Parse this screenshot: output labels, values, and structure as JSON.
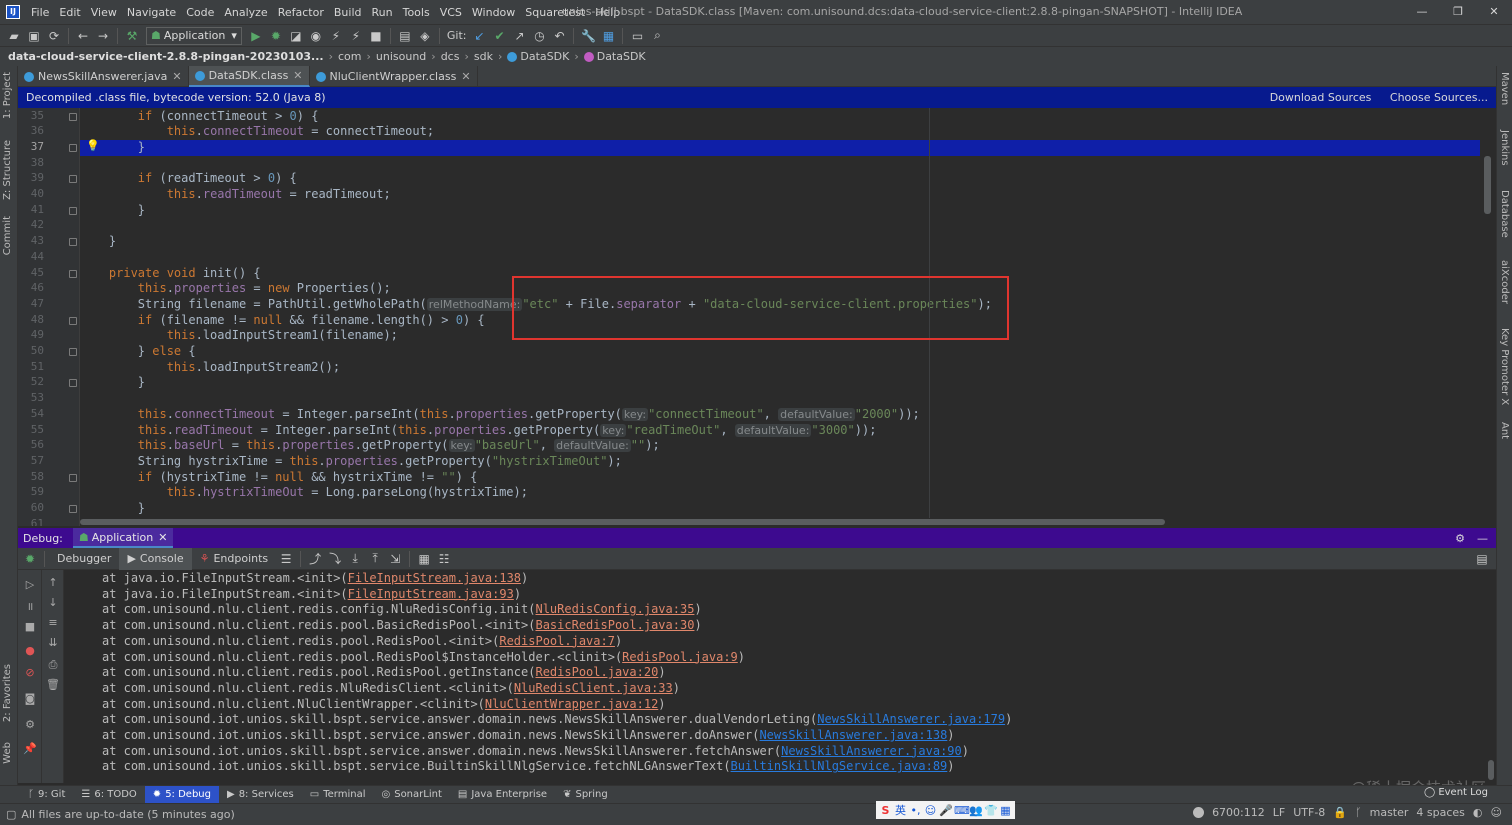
{
  "window": {
    "title": "unios-skill-bspt - DataSDK.class [Maven: com.unisound.dcs:data-cloud-service-client:2.8.8-pingan-SNAPSHOT] - IntelliJ IDEA",
    "menu": [
      "File",
      "Edit",
      "View",
      "Navigate",
      "Code",
      "Analyze",
      "Refactor",
      "Build",
      "Run",
      "Tools",
      "VCS",
      "Window",
      "Squaretest",
      "Help"
    ],
    "controls": [
      "—",
      "❐",
      "✕"
    ]
  },
  "toolbar": {
    "run_config": "Application",
    "git_label": "Git:"
  },
  "breadcrumb": [
    "data-cloud-service-client-2.8.8-pingan-20230103...",
    "com",
    "unisound",
    "dcs",
    "sdk",
    "DataSDK",
    "DataSDK"
  ],
  "left_tools": [
    "1: Project",
    "Z: Structure",
    "Commit"
  ],
  "right_tools": [
    "Maven",
    "Jenkins",
    "Database",
    "aiXcoder",
    "Key Promoter X",
    "Ant"
  ],
  "editor_tabs": [
    {
      "label": "NewsSkillAnswerer.java",
      "active": false
    },
    {
      "label": "DataSDK.class",
      "active": true
    },
    {
      "label": "NluClientWrapper.class",
      "active": false
    }
  ],
  "banner": {
    "text": "Decompiled .class file, bytecode version: 52.0 (Java 8)",
    "links": [
      "Download Sources",
      "Choose Sources..."
    ]
  },
  "editor": {
    "current_line": 37,
    "lines": [
      {
        "n": "35",
        "fold": true,
        "parts": [
          [
            "",
            "        "
          ],
          [
            "kw",
            "if"
          ],
          [
            "",
            " (connectTimeout > "
          ],
          [
            "num",
            "0"
          ],
          [
            "",
            ") {"
          ]
        ]
      },
      {
        "n": "36",
        "fold": false,
        "parts": [
          [
            "",
            "            "
          ],
          [
            "kw",
            "this"
          ],
          [
            "",
            "."
          ],
          [
            "fld",
            "connectTimeout"
          ],
          [
            "",
            " = connectTimeout;"
          ]
        ]
      },
      {
        "n": "37",
        "fold": true,
        "bulb": true,
        "parts": [
          [
            "",
            "        }"
          ]
        ]
      },
      {
        "n": "38",
        "fold": false,
        "parts": []
      },
      {
        "n": "39",
        "fold": true,
        "parts": [
          [
            "",
            "        "
          ],
          [
            "kw",
            "if"
          ],
          [
            "",
            " (readTimeout > "
          ],
          [
            "num",
            "0"
          ],
          [
            "",
            ") {"
          ]
        ]
      },
      {
        "n": "40",
        "fold": false,
        "parts": [
          [
            "",
            "            "
          ],
          [
            "kw",
            "this"
          ],
          [
            "",
            "."
          ],
          [
            "fld",
            "readTimeout"
          ],
          [
            "",
            " = readTimeout;"
          ]
        ]
      },
      {
        "n": "41",
        "fold": true,
        "parts": [
          [
            "",
            "        }"
          ]
        ]
      },
      {
        "n": "42",
        "fold": false,
        "parts": []
      },
      {
        "n": "43",
        "fold": true,
        "parts": [
          [
            "",
            "    }"
          ]
        ]
      },
      {
        "n": "44",
        "fold": false,
        "parts": []
      },
      {
        "n": "45",
        "fold": true,
        "parts": [
          [
            "",
            "    "
          ],
          [
            "kw",
            "private void"
          ],
          [
            "",
            " init() {"
          ]
        ]
      },
      {
        "n": "46",
        "fold": false,
        "parts": [
          [
            "",
            "        "
          ],
          [
            "kw",
            "this"
          ],
          [
            "",
            "."
          ],
          [
            "fld",
            "properties"
          ],
          [
            "",
            " = "
          ],
          [
            "kw",
            "new"
          ],
          [
            "",
            " Properties();"
          ]
        ]
      },
      {
        "n": "47",
        "fold": false,
        "parts": [
          [
            "",
            "        String filename = PathUtil.getWholePath("
          ],
          [
            "hint",
            "relMethodName:"
          ],
          [
            "str",
            "\"etc\""
          ],
          [
            "",
            " + File."
          ],
          [
            "fld",
            "separator"
          ],
          [
            "",
            " + "
          ],
          [
            "str",
            "\"data-cloud-service-client.properties\""
          ],
          [
            "",
            ");"
          ]
        ]
      },
      {
        "n": "48",
        "fold": true,
        "parts": [
          [
            "",
            "        "
          ],
          [
            "kw",
            "if"
          ],
          [
            "",
            " (filename != "
          ],
          [
            "kw",
            "null"
          ],
          [
            "",
            " && filename.length() > "
          ],
          [
            "num",
            "0"
          ],
          [
            "",
            ") {"
          ]
        ]
      },
      {
        "n": "49",
        "fold": false,
        "parts": [
          [
            "",
            "            "
          ],
          [
            "kw",
            "this"
          ],
          [
            "",
            ".loadInputStream1(filename);"
          ]
        ]
      },
      {
        "n": "50",
        "fold": true,
        "parts": [
          [
            "",
            "        } "
          ],
          [
            "kw",
            "else"
          ],
          [
            "",
            " {"
          ]
        ]
      },
      {
        "n": "51",
        "fold": false,
        "parts": [
          [
            "",
            "            "
          ],
          [
            "kw",
            "this"
          ],
          [
            "",
            ".loadInputStream2();"
          ]
        ]
      },
      {
        "n": "52",
        "fold": true,
        "parts": [
          [
            "",
            "        }"
          ]
        ]
      },
      {
        "n": "53",
        "fold": false,
        "parts": []
      },
      {
        "n": "54",
        "fold": false,
        "parts": [
          [
            "",
            "        "
          ],
          [
            "kw",
            "this"
          ],
          [
            "",
            "."
          ],
          [
            "fld",
            "connectTimeout"
          ],
          [
            "",
            " = Integer.parseInt("
          ],
          [
            "kw",
            "this"
          ],
          [
            "",
            "."
          ],
          [
            "fld",
            "properties"
          ],
          [
            "",
            ".getProperty("
          ],
          [
            "hint",
            "key:"
          ],
          [
            "str",
            "\"connectTimeout\""
          ],
          [
            "",
            ", "
          ],
          [
            "hint",
            "defaultValue:"
          ],
          [
            "str",
            "\"2000\""
          ],
          [
            "",
            "));"
          ]
        ]
      },
      {
        "n": "55",
        "fold": false,
        "parts": [
          [
            "",
            "        "
          ],
          [
            "kw",
            "this"
          ],
          [
            "",
            "."
          ],
          [
            "fld",
            "readTimeout"
          ],
          [
            "",
            " = Integer.parseInt("
          ],
          [
            "kw",
            "this"
          ],
          [
            "",
            "."
          ],
          [
            "fld",
            "properties"
          ],
          [
            "",
            ".getProperty("
          ],
          [
            "hint",
            "key:"
          ],
          [
            "str",
            "\"readTimeOut\""
          ],
          [
            "",
            ", "
          ],
          [
            "hint",
            "defaultValue:"
          ],
          [
            "str",
            "\"3000\""
          ],
          [
            "",
            "));"
          ]
        ]
      },
      {
        "n": "56",
        "fold": false,
        "parts": [
          [
            "",
            "        "
          ],
          [
            "kw",
            "this"
          ],
          [
            "",
            "."
          ],
          [
            "fld",
            "baseUrl"
          ],
          [
            "",
            " = "
          ],
          [
            "kw",
            "this"
          ],
          [
            "",
            "."
          ],
          [
            "fld",
            "properties"
          ],
          [
            "",
            ".getProperty("
          ],
          [
            "hint",
            "key:"
          ],
          [
            "str",
            "\"baseUrl\""
          ],
          [
            "",
            ", "
          ],
          [
            "hint",
            "defaultValue:"
          ],
          [
            "str",
            "\"\""
          ],
          [
            "",
            ");"
          ]
        ]
      },
      {
        "n": "57",
        "fold": false,
        "parts": [
          [
            "",
            "        String hystrixTime = "
          ],
          [
            "kw",
            "this"
          ],
          [
            "",
            "."
          ],
          [
            "fld",
            "properties"
          ],
          [
            "",
            ".getProperty("
          ],
          [
            "str",
            "\"hystrixTimeOut\""
          ],
          [
            "",
            ");"
          ]
        ]
      },
      {
        "n": "58",
        "fold": true,
        "parts": [
          [
            "",
            "        "
          ],
          [
            "kw",
            "if"
          ],
          [
            "",
            " (hystrixTime != "
          ],
          [
            "kw",
            "null"
          ],
          [
            "",
            " && hystrixTime != "
          ],
          [
            "str",
            "\"\""
          ],
          [
            "",
            ") {"
          ]
        ]
      },
      {
        "n": "59",
        "fold": false,
        "parts": [
          [
            "",
            "            "
          ],
          [
            "kw",
            "this"
          ],
          [
            "",
            "."
          ],
          [
            "fld",
            "hystrixTimeOut"
          ],
          [
            "",
            " = Long.parseLong(hystrixTime);"
          ]
        ]
      },
      {
        "n": "60",
        "fold": true,
        "parts": [
          [
            "",
            "        }"
          ]
        ]
      },
      {
        "n": "61",
        "fold": false,
        "parts": []
      }
    ]
  },
  "debug": {
    "label": "Debug:",
    "config_tab": "Application",
    "tabs": [
      "Debugger",
      "Console",
      "Endpoints"
    ],
    "console_lines": [
      {
        "pre": "at java.io.FileInputStream.<init>(",
        "link": "FileInputStream.java:138",
        "post": ")",
        "cls": true
      },
      {
        "pre": "at java.io.FileInputStream.<init>(",
        "link": "FileInputStream.java:93",
        "post": ")",
        "cls": true
      },
      {
        "pre": "at com.unisound.nlu.client.redis.config.NluRedisConfig.init(",
        "link": "NluRedisConfig.java:35",
        "post": ")",
        "cls": true
      },
      {
        "pre": "at com.unisound.nlu.client.redis.pool.BasicRedisPool.<init>(",
        "link": "BasicRedisPool.java:30",
        "post": ")",
        "cls": true
      },
      {
        "pre": "at com.unisound.nlu.client.redis.pool.RedisPool.<init>(",
        "link": "RedisPool.java:7",
        "post": ")",
        "cls": true
      },
      {
        "pre": "at com.unisound.nlu.client.redis.pool.RedisPool$InstanceHolder.<clinit>(",
        "link": "RedisPool.java:9",
        "post": ")",
        "cls": true
      },
      {
        "pre": "at com.unisound.nlu.client.redis.pool.RedisPool.getInstance(",
        "link": "RedisPool.java:20",
        "post": ")",
        "cls": true
      },
      {
        "pre": "at com.unisound.nlu.client.redis.NluRedisClient.<clinit>(",
        "link": "NluRedisClient.java:33",
        "post": ")",
        "cls": true
      },
      {
        "pre": "at com.unisound.nlu.client.NluClientWrapper.<clinit>(",
        "link": "NluClientWrapper.java:12",
        "post": ")",
        "cls": true
      },
      {
        "pre": "at com.unisound.iot.unios.skill.bspt.service.answer.domain.news.NewsSkillAnswerer.dualVendorLeting(",
        "link": "NewsSkillAnswerer.java:179",
        "post": ")",
        "cls": false
      },
      {
        "pre": "at com.unisound.iot.unios.skill.bspt.service.answer.domain.news.NewsSkillAnswerer.doAnswer(",
        "link": "NewsSkillAnswerer.java:138",
        "post": ")",
        "cls": false
      },
      {
        "pre": "at com.unisound.iot.unios.skill.bspt.service.answer.domain.news.NewsSkillAnswerer.fetchAnswer(",
        "link": "NewsSkillAnswerer.java:90",
        "post": ")",
        "cls": false
      },
      {
        "pre": "at com.unisound.iot.unios.skill.bspt.service.BuiltinSkillNlgService.fetchNLGAnswerText(",
        "link": "BuiltinSkillNlgService.java:89",
        "post": ")",
        "cls": false
      }
    ]
  },
  "bottom_tabs": [
    {
      "label": "9: Git",
      "icon": "git-icon",
      "active": false
    },
    {
      "label": "6: TODO",
      "icon": "todo-icon",
      "active": false
    },
    {
      "label": "5: Debug",
      "icon": "debug-icon",
      "active": true
    },
    {
      "label": "8: Services",
      "icon": "services-icon",
      "active": false
    },
    {
      "label": "Terminal",
      "icon": "terminal-icon",
      "active": false
    },
    {
      "label": "SonarLint",
      "icon": "sonarlint-icon",
      "active": false
    },
    {
      "label": "Java Enterprise",
      "icon": "java-enterprise-icon",
      "active": false
    },
    {
      "label": "Spring",
      "icon": "spring-icon",
      "active": false
    }
  ],
  "left_bottom_tools": [
    "2: Favorites",
    "Web"
  ],
  "event_log": "Event Log",
  "status": {
    "message": "All files are up-to-date (5 minutes ago)",
    "position": "6700:112",
    "line_sep": "LF",
    "encoding": "UTF-8",
    "branch": "master",
    "indent": "4 spaces"
  },
  "ime": [
    "S",
    "英",
    "•,",
    "☺",
    "🎤",
    "⌨",
    "👥",
    "👕",
    "▦"
  ],
  "watermark": "@稀土掘金技术社区",
  "colors": {
    "banner": "#071a8e",
    "debug_header": "#3d0a8f",
    "current_line": "#0f1fa8",
    "highlight_box": "#e0352f",
    "active_bottom_tab": "#2d52c8"
  }
}
